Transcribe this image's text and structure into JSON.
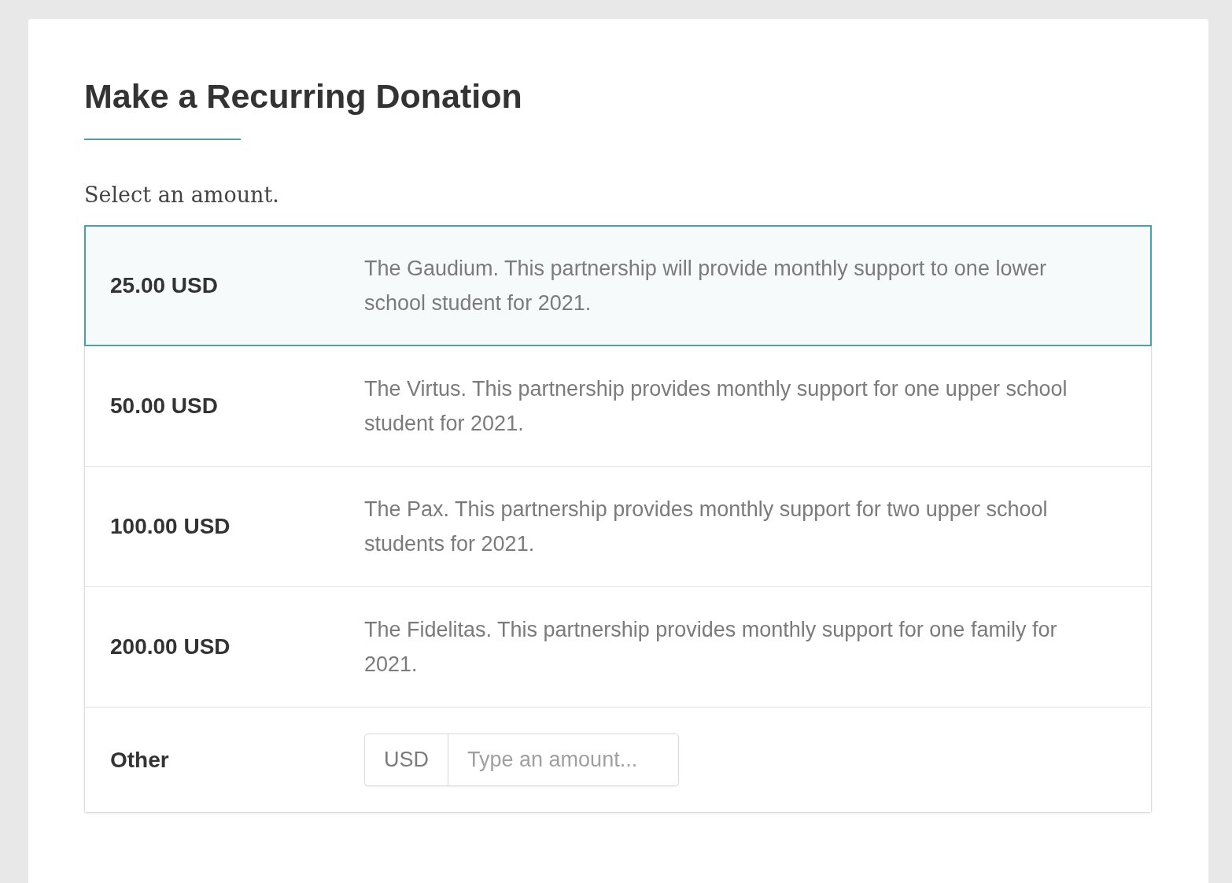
{
  "title": "Make a Recurring Donation",
  "prompt": "Select an amount.",
  "options": [
    {
      "kind": "preset",
      "amount": "25.00 USD",
      "description": "The Gaudium. This partnership will provide monthly support to one lower school student for 2021.",
      "selected": true
    },
    {
      "kind": "preset",
      "amount": "50.00 USD",
      "description": "The Virtus. This partnership provides monthly support for one upper school student for 2021.",
      "selected": false
    },
    {
      "kind": "preset",
      "amount": "100.00 USD",
      "description": "The Pax. This partnership provides monthly support for two upper school students for 2021.",
      "selected": false
    },
    {
      "kind": "preset",
      "amount": "200.00 USD",
      "description": "The Fidelitas. This partnership provides monthly support for one family for 2021.",
      "selected": false
    },
    {
      "kind": "other",
      "label": "Other",
      "currency": "USD",
      "placeholder": "Type an amount...",
      "selected": false
    }
  ]
}
